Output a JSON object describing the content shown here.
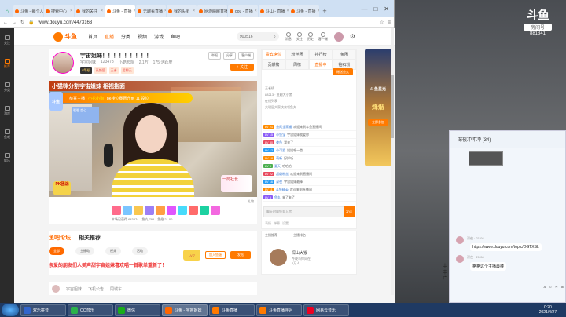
{
  "browser": {
    "tabs": [
      {
        "label": "斗鱼 - 每个人的直播平台",
        "active": false
      },
      {
        "label": "搜索中心",
        "active": false
      },
      {
        "label": "我的关注",
        "active": false
      },
      {
        "label": "斗鱼 - 直播",
        "active": true
      },
      {
        "label": "无聊看直播",
        "active": false
      },
      {
        "label": "我的头衔",
        "active": false
      },
      {
        "label": "网游睡眠直播",
        "active": false
      },
      {
        "label": "dou - 直播",
        "active": false
      },
      {
        "label": "斗山 - 直播",
        "active": false
      },
      {
        "label": "斗鱼 - 直播",
        "active": false
      }
    ],
    "url": "www.douyu.com/4473163",
    "new_tab": "+",
    "win_min": "—",
    "win_max": "□",
    "win_close": "✕"
  },
  "left_nav": [
    {
      "label": "关注",
      "active": false
    },
    {
      "label": "推荐",
      "active": true
    },
    {
      "label": "分类",
      "active": false
    },
    {
      "label": "游戏",
      "active": false
    },
    {
      "label": "鱼吧",
      "active": false
    },
    {
      "label": "娱乐",
      "active": false
    }
  ],
  "header": {
    "logo_text": "斗鱼",
    "nav": [
      "首页",
      "直播",
      "分类",
      "视频",
      "游戏",
      "鱼吧"
    ],
    "nav_active": 1,
    "search_value": "900516",
    "icons": [
      "消息",
      "关注",
      "历史",
      "客户端"
    ]
  },
  "room": {
    "title": "宇宙姐妹！！！！！！！！！",
    "meta": [
      "宇宙姐妹",
      "123478",
      "小酷宏观",
      "2.1万",
      "175 活跃度"
    ],
    "tags": [
      "V等级",
      "高颜值",
      "王者",
      "爱聊天"
    ],
    "buttons": [
      "举报",
      "分享",
      "客户端"
    ],
    "follow": "+ 关注"
  },
  "video": {
    "banner_top": "小猫咪分割宇宙姐妹 相视抱面",
    "banner_2_pre": "恭喜主播",
    "banner_2_hl": "小花小狗",
    "banner_2_post": "pk排位赛晋升到 11 段位",
    "left_badge": "斗鱼",
    "pip_text": "暖暖 恋心",
    "corner_tag": "一局社长",
    "bl_tag": "PK团战"
  },
  "giftbar": {
    "info": [
      "本场已获得 643374",
      "鱼丸 795",
      "鱼翅 21.00"
    ],
    "r2": "礼物"
  },
  "bottom": {
    "tabs": [
      "鱼吧论坛",
      "相关推荐"
    ],
    "chips": [
      "全部",
      "主播动",
      "视频",
      "活动"
    ],
    "headline": "亲爱的朋友们人美声甜宇宙姐妹喜欢唱一首歌单重新了！",
    "join": "加入鱼塘",
    "send": "发帖",
    "lv": "LV 7"
  },
  "below": [
    "宇宙姐妹",
    "飞机公告",
    "同城车"
  ],
  "chat": {
    "tabs": [
      "贵宾席位",
      "粉丝团",
      "排行榜",
      "鱼团"
    ],
    "tabs2": [
      "贡献榜",
      "周榜",
      "直播中",
      "钻石粉"
    ],
    "pill": "赠送鱼丸",
    "sub": [
      "王者榜",
      "88213 · 鱼翅大小黑",
      "在线列表",
      "大明星大家快来领鱼丸"
    ],
    "messages": [
      {
        "lv": "LV 21",
        "color": "#ff8c00",
        "name": "鱼尾全家福",
        "text": "欢迎来到斗鱼直播间"
      },
      {
        "lv": "LV 15",
        "color": "#8a5cf6",
        "name": "小鱼宝",
        "text": "宇宙姐妹我爱你"
      },
      {
        "lv": "LV 30",
        "color": "#e84a5f",
        "name": "夜色",
        "text": "我来了"
      },
      {
        "lv": "LV 12",
        "color": "#2a9df4",
        "name": "小可爱",
        "text": "姐姐唱一首"
      },
      {
        "lv": "LV 18",
        "color": "#ff8c00",
        "name": "萌新",
        "text": "好好听"
      },
      {
        "lv": "LV 9",
        "color": "#4caf50",
        "name": "夏天",
        "text": "哈哈哈"
      },
      {
        "lv": "LV 22",
        "color": "#e84a5f",
        "name": "超级粉丝",
        "text": "欢迎来到直播间"
      },
      {
        "lv": "LV 16",
        "color": "#2a9df4",
        "name": "深夜",
        "text": "宇宙姐妹最棒"
      },
      {
        "lv": "LV 11",
        "color": "#ff8c00",
        "name": "斗鱼精英",
        "text": "欢迎来到直播间"
      },
      {
        "lv": "LV 8",
        "color": "#8a5cf6",
        "name": "鱼丸",
        "text": "来了来了"
      }
    ],
    "input_placeholder": "聊天时聊鱼丸入宫",
    "send": "发送",
    "foot": [
      "表情",
      "弹幕",
      "设置"
    ]
  },
  "subpanel": {
    "tabs": [
      "主播推荐",
      "主播排名"
    ],
    "name": "深山大猴",
    "sub": [
      "今晚与你同在",
      "2万人"
    ]
  },
  "ad": {
    "t1": "斗鱼星光",
    "t2": "烽烟",
    "btn": "立即参加"
  },
  "wallpaper": {
    "logo_big": "斗鱼",
    "logo_small": "房间号",
    "logo_id": "881341"
  },
  "qq": {
    "title": "深夜冲冲冲 (34)",
    "msg1_meta": "深夜 · 21:08",
    "link": "https://www.douyu.com/topic/DGTXSL",
    "msg2": "格格这个主播最棒",
    "left_text": [
      "中",
      "中",
      "广"
    ],
    "toolbar": [
      "A",
      "☺",
      "✂",
      "⊞"
    ]
  },
  "taskbar": {
    "items": [
      "欢乐拼音",
      "QQ音乐",
      "微信",
      "斗鱼 - 宇宙姐妹",
      "斗鱼直播",
      "斗鱼直播伴侣",
      "网易云音乐"
    ],
    "active": 3,
    "time": "0:20",
    "date": "2021/4/27"
  }
}
